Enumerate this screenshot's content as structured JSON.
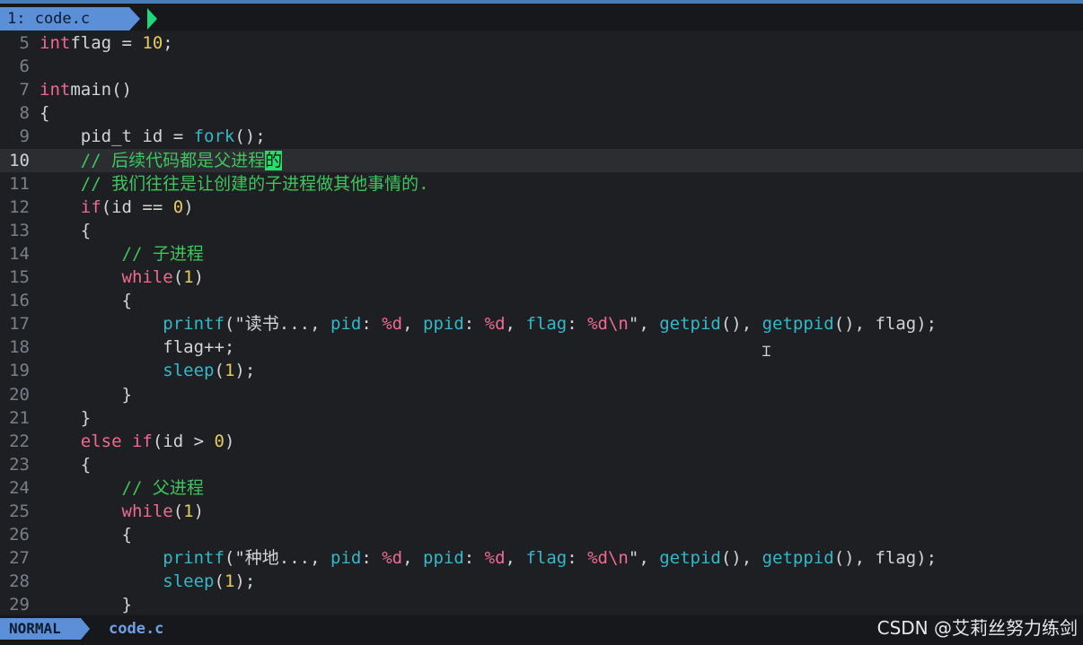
{
  "tab": {
    "label": "1: code.c"
  },
  "colors": {
    "accent": "#5b8fd8",
    "cursor": "#22e06a",
    "keyword": "#ef6a8e",
    "function": "#33b8c9",
    "number": "#e6cb5c",
    "comment": "#3fc45e"
  },
  "editor": {
    "current_line": 10,
    "lines": [
      {
        "n": "5",
        "tokens": [
          [
            "kw",
            "int"
          ],
          [
            "",
            "flag = "
          ],
          [
            "num",
            "10"
          ],
          [
            "",
            ";"
          ]
        ]
      },
      {
        "n": "6",
        "tokens": []
      },
      {
        "n": "7",
        "tokens": [
          [
            "kw",
            "int"
          ],
          [
            "",
            "main()"
          ]
        ]
      },
      {
        "n": "8",
        "tokens": [
          [
            "",
            "{"
          ]
        ]
      },
      {
        "n": "9",
        "tokens": [
          [
            "",
            "    pid_t id = "
          ],
          [
            "fn",
            "fork"
          ],
          [
            "",
            "();"
          ]
        ]
      },
      {
        "n": "10",
        "tokens": [
          [
            "cm",
            "    // 后续代码都是父进程"
          ],
          [
            "cursor",
            "的"
          ]
        ]
      },
      {
        "n": "11",
        "tokens": [
          [
            "cm",
            "    // 我们往往是让创建的子进程做其他事情的."
          ]
        ]
      },
      {
        "n": "12",
        "tokens": [
          [
            "",
            "    "
          ],
          [
            "kw",
            "if"
          ],
          [
            "",
            "(id == "
          ],
          [
            "num",
            "0"
          ],
          [
            "",
            ")"
          ]
        ]
      },
      {
        "n": "13",
        "tokens": [
          [
            "",
            "    {"
          ]
        ]
      },
      {
        "n": "14",
        "tokens": [
          [
            "cm",
            "        // 子进程"
          ]
        ]
      },
      {
        "n": "15",
        "tokens": [
          [
            "",
            "        "
          ],
          [
            "kw",
            "while"
          ],
          [
            "",
            "("
          ],
          [
            "num",
            "1"
          ],
          [
            "",
            ")"
          ]
        ]
      },
      {
        "n": "16",
        "tokens": [
          [
            "",
            "        {"
          ]
        ]
      },
      {
        "n": "17",
        "tokens": [
          [
            "",
            "            "
          ],
          [
            "fn",
            "printf"
          ],
          [
            "str",
            "(\"读书..., "
          ],
          [
            "fn",
            "pid"
          ],
          [
            "str",
            ": "
          ],
          [
            "fmt",
            "%d"
          ],
          [
            "str",
            ", "
          ],
          [
            "fn",
            "ppid"
          ],
          [
            "str",
            ": "
          ],
          [
            "fmt",
            "%d"
          ],
          [
            "str",
            ", "
          ],
          [
            "fn",
            "flag"
          ],
          [
            "str",
            ": "
          ],
          [
            "fmt",
            "%d"
          ],
          [
            "esc",
            "\\n"
          ],
          [
            "str",
            "\", "
          ],
          [
            "fn",
            "getpid"
          ],
          [
            "",
            "(), "
          ],
          [
            "fn",
            "getppid"
          ],
          [
            "",
            "(), flag);"
          ]
        ]
      },
      {
        "n": "18",
        "tokens": [
          [
            "",
            "            flag++;"
          ]
        ]
      },
      {
        "n": "19",
        "tokens": [
          [
            "",
            "            "
          ],
          [
            "fn",
            "sleep"
          ],
          [
            "",
            "("
          ],
          [
            "num",
            "1"
          ],
          [
            "",
            ");"
          ]
        ]
      },
      {
        "n": "20",
        "tokens": [
          [
            "",
            "        }"
          ]
        ]
      },
      {
        "n": "21",
        "tokens": [
          [
            "",
            "    }"
          ]
        ]
      },
      {
        "n": "22",
        "tokens": [
          [
            "",
            "    "
          ],
          [
            "kw",
            "else if"
          ],
          [
            "",
            "(id > "
          ],
          [
            "num",
            "0"
          ],
          [
            "",
            ")"
          ]
        ]
      },
      {
        "n": "23",
        "tokens": [
          [
            "",
            "    {"
          ]
        ]
      },
      {
        "n": "24",
        "tokens": [
          [
            "cm",
            "        // 父进程"
          ]
        ]
      },
      {
        "n": "25",
        "tokens": [
          [
            "",
            "        "
          ],
          [
            "kw",
            "while"
          ],
          [
            "",
            "("
          ],
          [
            "num",
            "1"
          ],
          [
            "",
            ")"
          ]
        ]
      },
      {
        "n": "26",
        "tokens": [
          [
            "",
            "        {"
          ]
        ]
      },
      {
        "n": "27",
        "tokens": [
          [
            "",
            "            "
          ],
          [
            "fn",
            "printf"
          ],
          [
            "str",
            "(\"种地..., "
          ],
          [
            "fn",
            "pid"
          ],
          [
            "str",
            ": "
          ],
          [
            "fmt",
            "%d"
          ],
          [
            "str",
            ", "
          ],
          [
            "fn",
            "ppid"
          ],
          [
            "str",
            ": "
          ],
          [
            "fmt",
            "%d"
          ],
          [
            "str",
            ", "
          ],
          [
            "fn",
            "flag"
          ],
          [
            "str",
            ": "
          ],
          [
            "fmt",
            "%d"
          ],
          [
            "esc",
            "\\n"
          ],
          [
            "str",
            "\", "
          ],
          [
            "fn",
            "getpid"
          ],
          [
            "",
            "(), "
          ],
          [
            "fn",
            "getppid"
          ],
          [
            "",
            "(), flag);"
          ]
        ]
      },
      {
        "n": "28",
        "tokens": [
          [
            "",
            "            "
          ],
          [
            "fn",
            "sleep"
          ],
          [
            "",
            "("
          ],
          [
            "num",
            "1"
          ],
          [
            "",
            ");"
          ]
        ]
      },
      {
        "n": "29",
        "tokens": [
          [
            "",
            "        }"
          ]
        ]
      }
    ]
  },
  "statusbar": {
    "mode": "NORMAL",
    "file": "code.c"
  },
  "watermark": "CSDN @艾莉丝努力练剑"
}
